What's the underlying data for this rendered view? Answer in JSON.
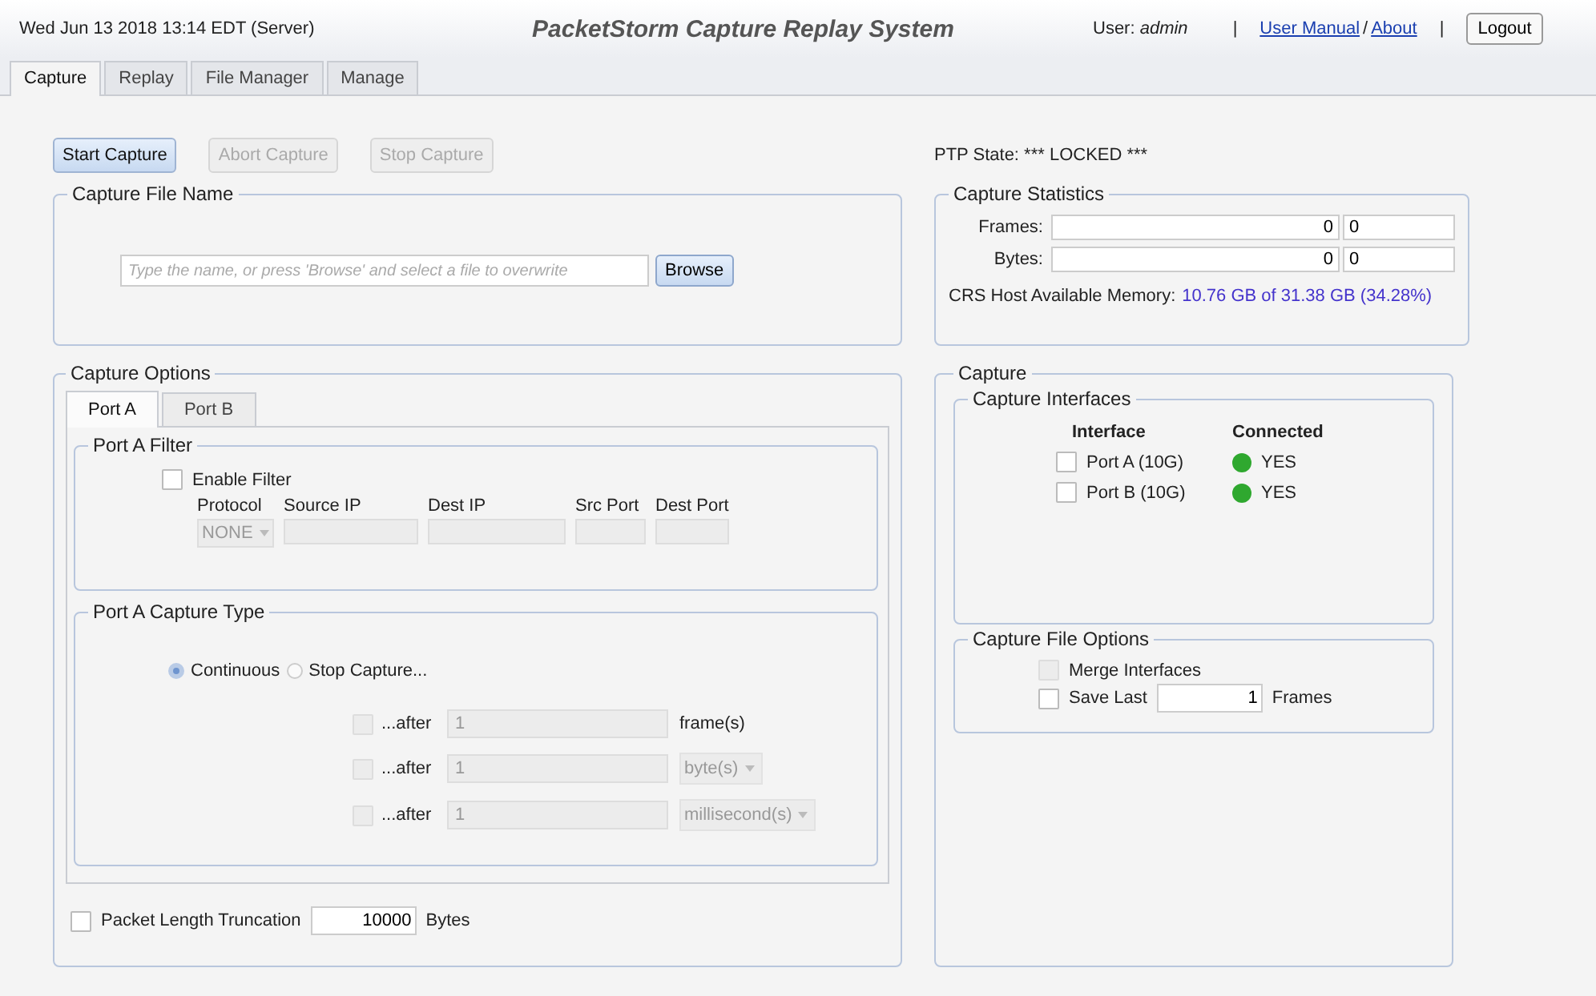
{
  "header": {
    "datetime": "Wed Jun 13 2018 13:14 EDT (Server)",
    "title": "PacketStorm Capture Replay System",
    "user": "User: *admin*",
    "separators": [
      "|",
      "/",
      "|"
    ],
    "links": [
      "User Manual",
      "About"
    ],
    "logout": "Logout"
  },
  "tabs": [
    {
      "label": "Capture",
      "selected": true
    },
    {
      "label": "Replay",
      "selected": false
    },
    {
      "label": "File Manager",
      "selected": false
    },
    {
      "label": "Manage",
      "selected": false
    }
  ],
  "actions": [
    {
      "label": "Start Capture",
      "disabled": false
    },
    {
      "label": "Abort Capture",
      "disabled": true
    },
    {
      "label": "Stop Capture",
      "disabled": true
    }
  ],
  "ptp_state": "PTP State: *** LOCKED ***",
  "capture_file_name": {
    "legend": "Capture File Name",
    "placeholder": "Type the name, or press 'Browse' and select a file to overwrite",
    "browse": "Browse"
  },
  "capture_options": {
    "legend": "Capture Options",
    "tabs": [
      {
        "label": "Port A",
        "selected": true
      },
      {
        "label": "Port B",
        "selected": false
      }
    ],
    "filter": {
      "legend": "Port A Filter",
      "enable": {
        "label": "Enable Filter",
        "checked": false
      },
      "columns": [
        "Protocol",
        "Source IP",
        "Dest IP",
        "Src Port",
        "Dest Port"
      ],
      "protocol": "NONE"
    },
    "capture_type": {
      "legend": "Port A Capture Type",
      "modes": [
        {
          "label": "Continuous",
          "selected": true
        },
        {
          "label": "Stop Capture...",
          "selected": false
        }
      ],
      "conditions": [
        {
          "kind": "text",
          "label": "...after",
          "value": "1",
          "unit": "frame(s)",
          "checked": false
        },
        {
          "kind": "select",
          "label": "...after",
          "value": "1",
          "unit": "byte(s)",
          "checked": false
        },
        {
          "kind": "select",
          "label": "...after",
          "value": "1",
          "unit": "millisecond(s)",
          "checked": false
        }
      ]
    },
    "truncation": {
      "label": "Packet Length Truncation",
      "checked": false,
      "value": "10000",
      "unit": "Bytes"
    }
  },
  "capture_statistics": {
    "legend": "Capture Statistics",
    "rows": [
      {
        "label": "Frames:",
        "value": "0",
        "value_2": "0"
      },
      {
        "label": "Bytes:",
        "value": "0",
        "value_2": "0"
      }
    ],
    "memory_label": "CRS Host Available Memory:",
    "memory_value": "10.76 GB of 31.38 GB (34.28%)"
  },
  "capture": {
    "legend": "Capture",
    "interfaces": {
      "legend": "Capture Interfaces",
      "columns": [
        "Interface",
        "Connected"
      ],
      "rows": [
        {
          "label": "Port A (10G)",
          "checked": false,
          "status": "YES",
          "color": "#2fa82f"
        },
        {
          "label": "Port B (10G)",
          "checked": false,
          "status": "YES",
          "color": "#2fa82f"
        }
      ]
    },
    "file_options": {
      "legend": "Capture File Options",
      "merge": {
        "label": "Merge Interfaces",
        "checked": false,
        "disabled": true
      },
      "save_last": {
        "label": "Save Last",
        "checked": false,
        "value": "1",
        "unit": "Frames"
      }
    }
  }
}
